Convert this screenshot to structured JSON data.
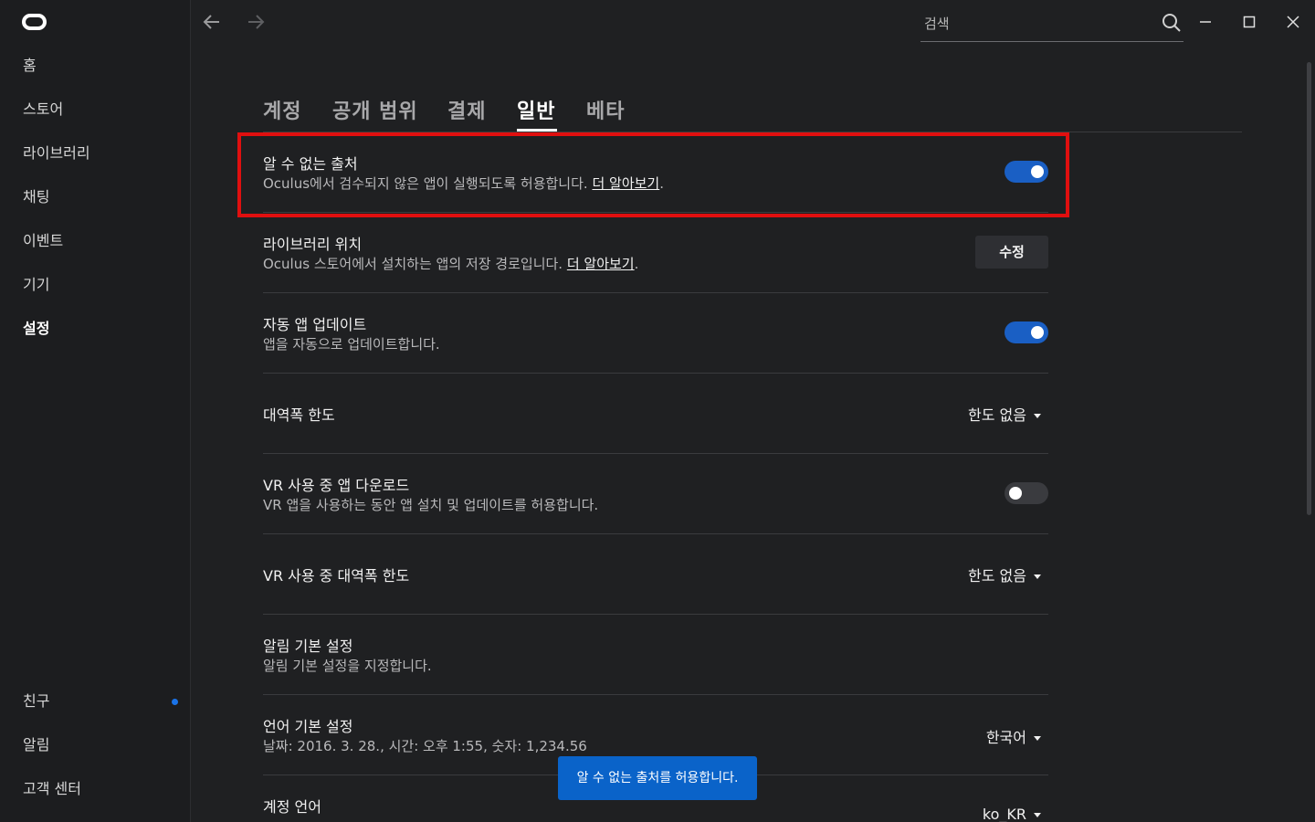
{
  "sidebar": {
    "items": [
      {
        "label": "홈"
      },
      {
        "label": "스토어"
      },
      {
        "label": "라이브러리"
      },
      {
        "label": "채팅"
      },
      {
        "label": "이벤트"
      },
      {
        "label": "기기"
      },
      {
        "label": "설정"
      }
    ],
    "bottom_items": [
      {
        "label": "친구"
      },
      {
        "label": "알림"
      },
      {
        "label": "고객 센터"
      }
    ]
  },
  "search": {
    "placeholder": "검색"
  },
  "tabs": [
    {
      "label": "계정"
    },
    {
      "label": "공개 범위"
    },
    {
      "label": "결제"
    },
    {
      "label": "일반"
    },
    {
      "label": "베타"
    }
  ],
  "settings": {
    "unknown_sources": {
      "title": "알 수 없는 출처",
      "desc": "Oculus에서 검수되지 않은 앱이 실행되도록 허용합니다.",
      "link": "더 알아보기",
      "suffix": "."
    },
    "library_location": {
      "title": "라이브러리 위치",
      "desc": "Oculus 스토어에서 설치하는 앱의 저장 경로입니다.",
      "link": "더 알아보기",
      "suffix": ".",
      "button": "수정"
    },
    "auto_update": {
      "title": "자동 앱 업데이트",
      "desc": "앱을 자동으로 업데이트합니다."
    },
    "bandwidth": {
      "title": "대역폭 한도",
      "value": "한도 없음"
    },
    "vr_download": {
      "title": "VR 사용 중 앱 다운로드",
      "desc": "VR 앱을 사용하는 동안 앱 설치 및 업데이트를 허용합니다."
    },
    "vr_bandwidth": {
      "title": "VR 사용 중 대역폭 한도",
      "value": "한도 없음"
    },
    "notifications": {
      "title": "알림 기본 설정",
      "desc": "알림 기본 설정을 지정합니다."
    },
    "language": {
      "title": "언어 기본 설정",
      "desc": "날짜: 2016. 3. 28., 시간: 오후 1:55, 숫자: 1,234.56",
      "value": "한국어"
    },
    "account_language": {
      "title": "계정 언어",
      "value": "ko_KR"
    }
  },
  "tooltip": {
    "text": "알 수 없는 출처를 허용합니다."
  },
  "colors": {
    "accent": "#1a5fc4",
    "highlight": "#e00f0f",
    "toast": "#0a63c9"
  }
}
